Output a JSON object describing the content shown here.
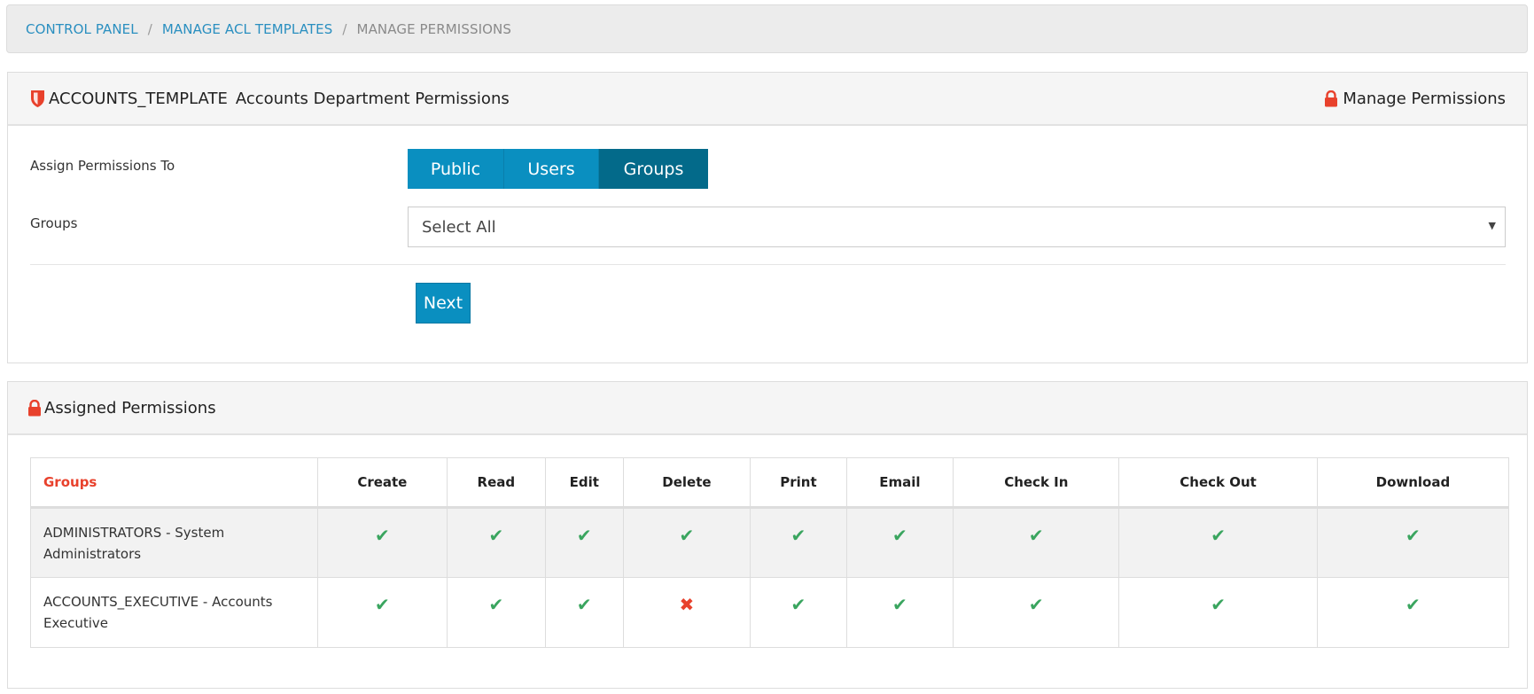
{
  "breadcrumb": {
    "items": [
      {
        "label": "CONTROL PANEL",
        "link": true
      },
      {
        "label": "MANAGE ACL TEMPLATES",
        "link": true
      },
      {
        "label": "MANAGE PERMISSIONS",
        "link": false
      }
    ],
    "separator": "/"
  },
  "template_panel": {
    "icon": "shield-icon",
    "template_name": "ACCOUNTS_TEMPLATE",
    "template_description": "Accounts Department Permissions",
    "right_icon": "lock-icon",
    "right_title": "Manage Permissions",
    "assign_label": "Assign Permissions To",
    "assign_options": [
      {
        "label": "Public",
        "active": false
      },
      {
        "label": "Users",
        "active": false
      },
      {
        "label": "Groups",
        "active": true
      }
    ],
    "groups_label": "Groups",
    "groups_select_value": "Select All",
    "next_label": "Next"
  },
  "assigned_panel": {
    "icon": "lock-icon",
    "title": "Assigned Permissions",
    "table": {
      "columns": [
        "Groups",
        "Create",
        "Read",
        "Edit",
        "Delete",
        "Print",
        "Email",
        "Check In",
        "Check Out",
        "Download"
      ],
      "rows": [
        {
          "name": "ADMINISTRATORS - System Administrators",
          "permissions": [
            true,
            true,
            true,
            true,
            true,
            true,
            true,
            true,
            true
          ]
        },
        {
          "name": "ACCOUNTS_EXECUTIVE - Accounts Executive",
          "permissions": [
            true,
            true,
            true,
            false,
            true,
            true,
            true,
            true,
            true
          ]
        }
      ]
    }
  },
  "colors": {
    "link": "#2a8fc0",
    "primary_button": "#0a8fc0",
    "active_button": "#036a8a",
    "accent_red": "#e8412c",
    "check_green": "#3aa55f"
  },
  "glyphs": {
    "check": "✔",
    "cross": "✖",
    "caret": "▼"
  }
}
